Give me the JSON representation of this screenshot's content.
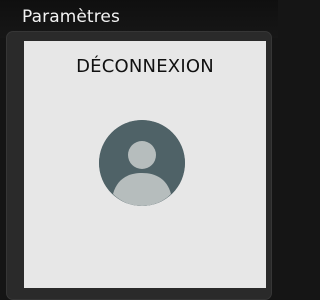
{
  "header": {
    "title": "Paramètres"
  },
  "card": {
    "title": "DÉCONNEXION"
  },
  "icons": {
    "avatar": "user-avatar-icon"
  },
  "colors": {
    "background": "#151515",
    "frame": "#2a2a2a",
    "card": "#e7e7e7",
    "avatar": "#4f6267",
    "avatarForeground": "#b6bdbd"
  }
}
